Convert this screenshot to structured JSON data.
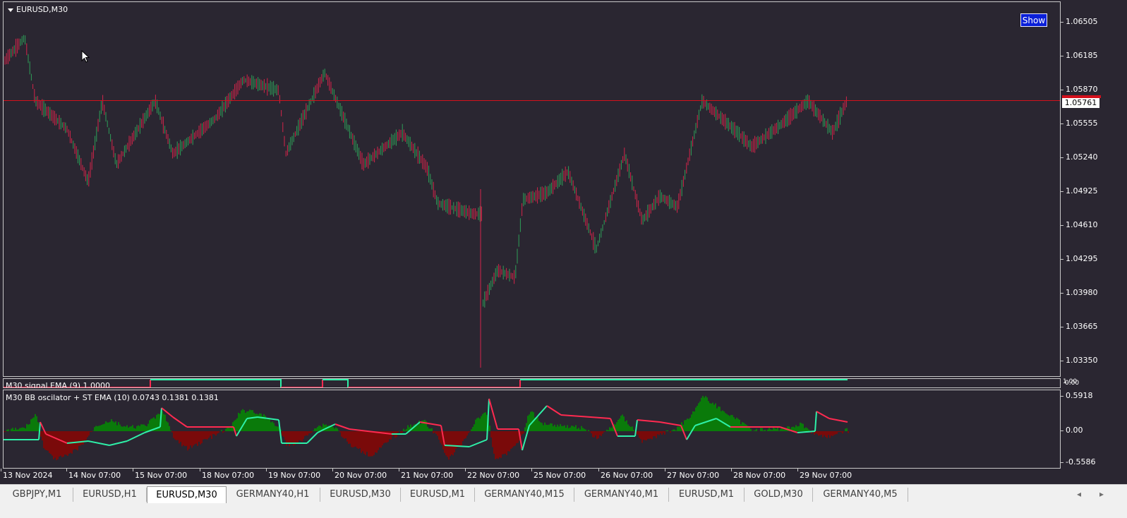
{
  "chart": {
    "symbol": "EURUSD,M30",
    "show_button": "Show",
    "current_price": "1.05761",
    "price_ticks": [
      "1.06505",
      "1.06185",
      "1.05870",
      "1.05555",
      "1.05240",
      "1.04925",
      "1.04610",
      "1.04295",
      "1.03980",
      "1.03665",
      "1.03350"
    ],
    "time_ticks": [
      "13 Nov 2024",
      "14 Nov 07:00",
      "15 Nov 07:00",
      "18 Nov 07:00",
      "19 Nov 07:00",
      "20 Nov 07:00",
      "21 Nov 07:00",
      "22 Nov 07:00",
      "25 Nov 07:00",
      "26 Nov 07:00",
      "27 Nov 07:00",
      "28 Nov 07:00",
      "29 Nov 07:00"
    ]
  },
  "indicators": {
    "ema_signal": {
      "label": "M30 signal EMA (9) 1.0000",
      "axis_top": "1.00",
      "axis_bottom": "0.00"
    },
    "bb_oscillator": {
      "label": "M30 BB oscilator + ST EMA (10) 0.0743 0.1381 0.1381",
      "ticks": [
        "0.5918",
        "0.00",
        "-0.5586"
      ]
    }
  },
  "colors": {
    "background": "#2a2631",
    "bull": "#2e9e58",
    "bear": "#d4244a",
    "price_line": "#d4101c",
    "osc_up": "#0a7a0a",
    "osc_down": "#7a0a0a",
    "signal_line": "#2ef0a8",
    "st_line": "#ff2a50"
  },
  "tabs": [
    "GBPJPY,M1",
    "EURUSD,H1",
    "EURUSD,M30",
    "GERMANY40,H1",
    "EURUSD,M30",
    "EURUSD,M1",
    "GERMANY40,M15",
    "GERMANY40,M1",
    "EURUSD,M1",
    "GOLD,M30",
    "GERMANY40,M5"
  ],
  "active_tab_index": 2,
  "icons": {
    "left_arrow": "chevron-left-icon",
    "right_arrow": "chevron-right-icon",
    "cursor": "mouse-pointer-icon"
  }
}
